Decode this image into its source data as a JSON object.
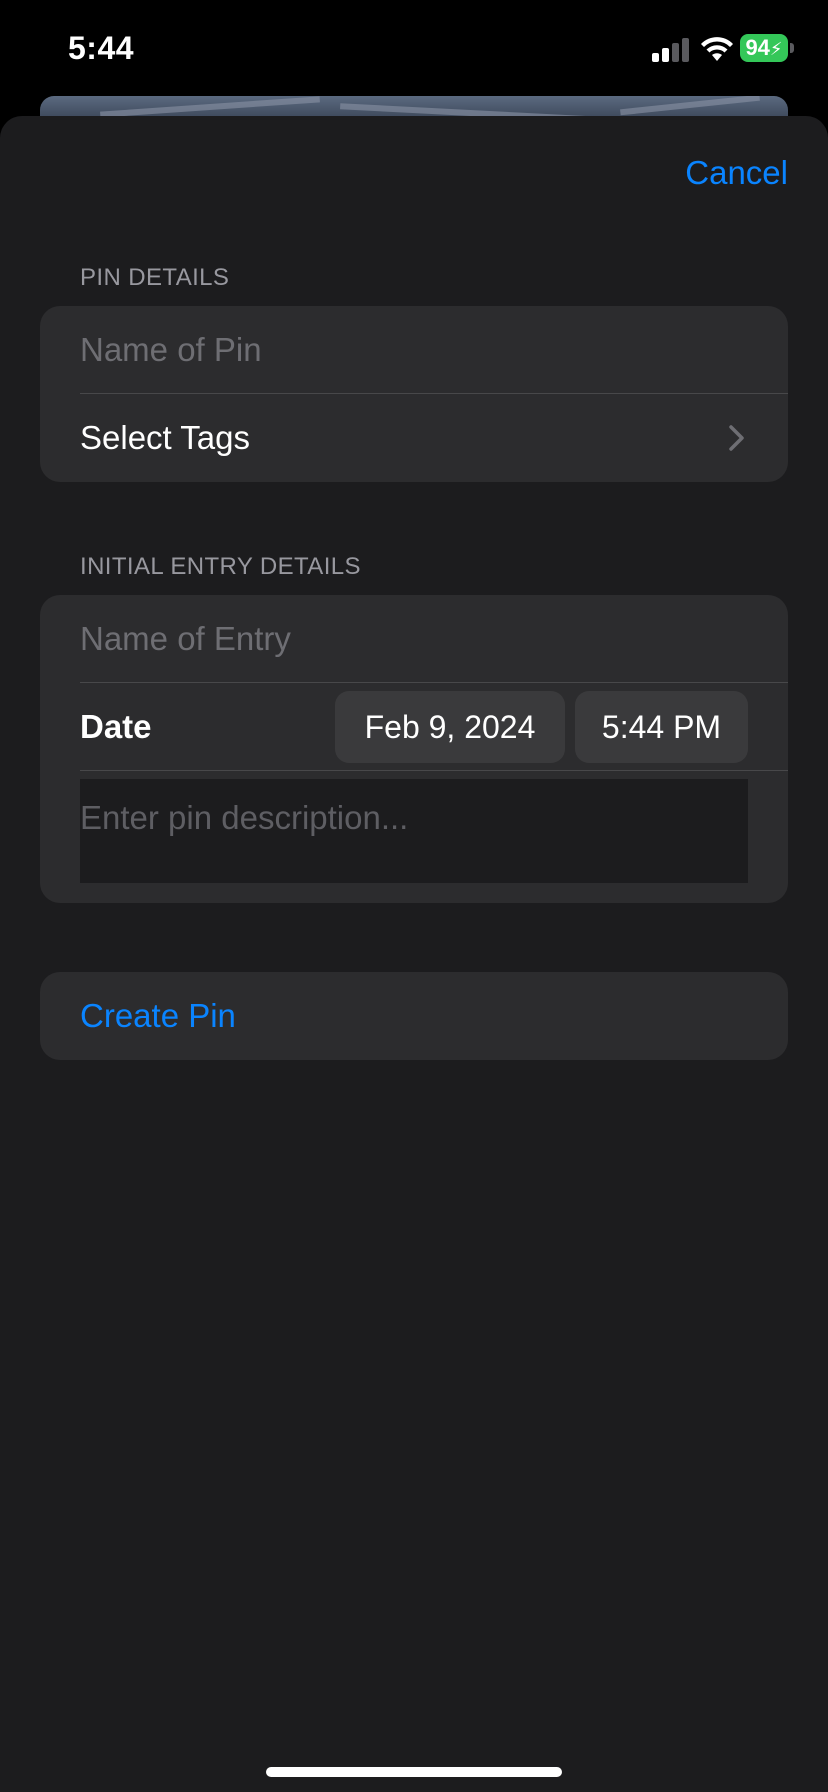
{
  "status_bar": {
    "time": "5:44",
    "battery_level": "94",
    "signal_bars_active": 2,
    "signal_bars_total": 4
  },
  "sheet": {
    "cancel_label": "Cancel",
    "pin_details": {
      "header": "PIN DETAILS",
      "name_placeholder": "Name of Pin",
      "tags_label": "Select Tags"
    },
    "initial_entry": {
      "header": "INITIAL ENTRY DETAILS",
      "name_placeholder": "Name of Entry",
      "date_label": "Date",
      "date_value": "Feb 9, 2024",
      "time_value": "5:44 PM",
      "description_placeholder": "Enter pin description..."
    },
    "create_label": "Create Pin"
  },
  "colors": {
    "accent": "#0a84ff",
    "sheet_bg": "#1c1c1e",
    "group_bg": "#2c2c2e",
    "battery": "#34c759"
  },
  "icons": [
    "cellular-signal-icon",
    "wifi-icon",
    "battery-charging-icon",
    "chevron-right-icon"
  ]
}
